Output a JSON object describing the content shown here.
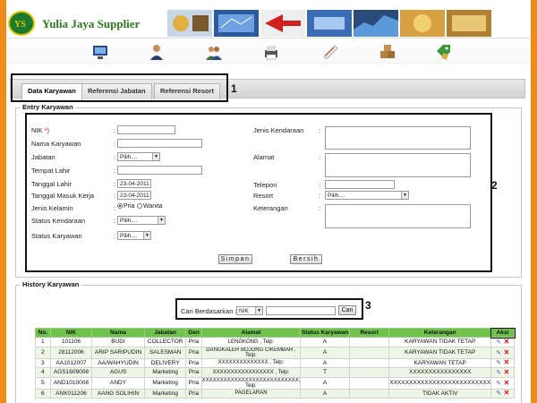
{
  "app": {
    "title": "Yulia Jaya Supplier",
    "logo_caption": "Yulia Jaya"
  },
  "toolbar": {
    "icons": [
      "monitor-icon",
      "user-icon",
      "users-icon",
      "printer-icon",
      "document-icon",
      "boxes-icon",
      "tag-icon"
    ]
  },
  "tabs": [
    {
      "label": "Data Karyawan"
    },
    {
      "label": "Referensi Jabatan"
    },
    {
      "label": "Referensi Resort"
    }
  ],
  "annotations": {
    "n1": "1",
    "n2": "2",
    "n3": "3"
  },
  "entry": {
    "legend": "Entry Karyawan",
    "nik_label": "NIK ",
    "nik_required": "*)",
    "nama_label": "Nama Karyawan",
    "jabatan_label": "Jabatan",
    "jabatan_value": "Pilih....",
    "tempat_label": "Tempat Lahir",
    "tgl_lahir_label": "Tanggal Lahir",
    "tgl_lahir_value": "23-04-2011",
    "tgl_masuk_label": "Tanggal Masuk Kerja",
    "tgl_masuk_value": "23-04-2011",
    "jk_label": "Jenis Kelamin",
    "jk_pria": "Pria",
    "jk_wanita": "Wanita",
    "status_kend_label": "Status Kendaraan",
    "status_kend_value": "Pilih....",
    "status_kary_label": "Status Karyawan",
    "status_kary_value": "Pilih....",
    "jenis_kend_label": "Jenis Kendaraan",
    "alamat_label": "Alamat",
    "telepon_label": "Telepon",
    "resort_label": "Resort",
    "resort_value": "Pilih....",
    "keterangan_label": "Keterangan",
    "colon": ":",
    "simpan": "Simpan",
    "bersih": "Bersih"
  },
  "history": {
    "legend": "History Karyawan",
    "search_label": "Cari Berdasarkan :",
    "search_field": "NIK",
    "search_button": "Cari",
    "columns": [
      "No.",
      "NIK",
      "Nama",
      "Jabatan",
      "Gen",
      "Alamat",
      "Status Karyawan",
      "Resort",
      "Keterangan",
      "Aksi"
    ],
    "rows": [
      [
        "1",
        "101106",
        "BUDI",
        "COLLECTOR",
        "Pria",
        "LENGKONG , Telp:",
        "A",
        "",
        "KARYAWAN TIDAK TETAP"
      ],
      [
        "2",
        "28112006",
        "ARIP SARIPUDIN",
        "SALESMAN",
        "Pria",
        "DANGKALER BOJONG CIKEMBAR , Telp:",
        "A",
        "",
        "KARYAWAN TIDAK TETAP"
      ],
      [
        "3",
        "AA1012007",
        "AA/WAHYUDIN",
        "DELIVERY",
        "Pria",
        "XXXXXXXXXXXXXX , Telp:",
        "A",
        "",
        "KARYAWAN TETAP"
      ],
      [
        "4",
        "AGS1609008",
        "AGUS",
        "Marketing",
        "Pria",
        "XXXXXXXXXXXXXXXXX , Telp:",
        "T",
        "",
        "XXXXXXXXXXXXXXXX"
      ],
      [
        "5",
        "AND1010008",
        "ANDY",
        "Marketing",
        "Pria",
        "XXXXXXXXXXXXXXXXXXXXXXXXXXX, Telp:",
        "A",
        "",
        "XXXXXXXXXXXXXXXXXXXXXXXXXX"
      ],
      [
        "6",
        "ANK011206",
        "AANG SOLIHIN",
        "Marketing",
        "Pria",
        "PAGELARAN",
        "A",
        "",
        "TIDAK AKTIV"
      ]
    ]
  },
  "colors": {
    "orange": "#f08c1a",
    "green_header": "#6fc24b"
  }
}
